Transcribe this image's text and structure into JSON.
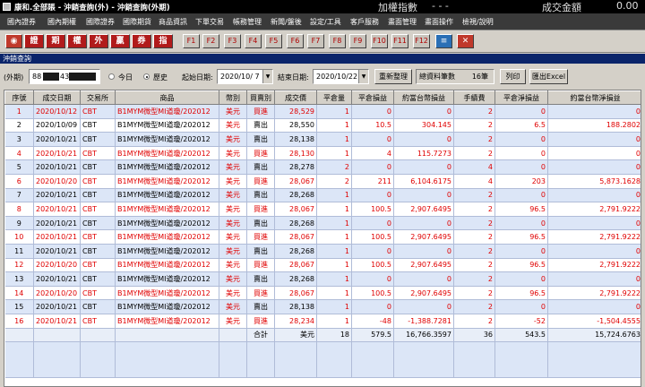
{
  "titlebar": {
    "title": "康和.全部賬 - 沖銷查詢(外) - 沖銷查詢(外期)",
    "index_label": "加權指數",
    "index_value": "- - -",
    "amount_label": "成交金額",
    "amount_value": "0.00"
  },
  "menu": [
    "國內證券",
    "國內期權",
    "國際證券",
    "國際期貨",
    "商品資訊",
    "下單交易",
    "帳務管理",
    "新聞/盤後",
    "設定/工具",
    "客戶服務",
    "畫面管理",
    "畫面操作",
    "檢視/說明"
  ],
  "toolbar": {
    "buttons": [
      "證",
      "期",
      "權",
      "外",
      "贏",
      "券",
      "指"
    ],
    "fkeys": [
      "F1",
      "F2",
      "F3",
      "F4",
      "F5",
      "F6",
      "F7",
      "F8",
      "F9",
      "F10",
      "F11",
      "F12"
    ]
  },
  "window": {
    "title": "沖銷查詢"
  },
  "filters": {
    "account_prefix": "(外期)",
    "account_visible": "88",
    "account_visible2": "43",
    "radio_today": "今日",
    "radio_history": "歷史",
    "start_label": "起始日期:",
    "start_date": "2020/10/ 7",
    "end_label": "結束日期:",
    "end_date": "2020/10/22",
    "reorganize": "重新整理",
    "total_count_label": "總資料筆數",
    "total_count": "16筆",
    "print": "列印",
    "export": "匯出Excel"
  },
  "columns": [
    "序號",
    "成交日期",
    "交易所",
    "商品",
    "幣別",
    "買賣別",
    "成交價",
    "平倉量",
    "平倉損益",
    "約當台幣損益",
    "手續費",
    "平倉淨損益",
    "約當台幣淨損益"
  ],
  "rows": [
    {
      "no": "1",
      "date": "2020/10/12",
      "ex": "CBT",
      "prod": "B1MYM微型MI道瓊/202012",
      "cur": "美元",
      "side": "買進",
      "price": "28,529",
      "qty": "1",
      "pl": "0",
      "twpl": "0",
      "fee": "2",
      "net": "0",
      "twnet": "0",
      "color": "red",
      "sidecolor": "buy"
    },
    {
      "no": "2",
      "date": "2020/10/09",
      "ex": "CBT",
      "prod": "B1MYM微型MI道瓊/202012",
      "cur": "美元",
      "side": "賣出",
      "price": "28,550",
      "qty": "1",
      "pl": "10.5",
      "twpl": "304.145",
      "fee": "2",
      "net": "6.5",
      "twnet": "188.2802",
      "color": "blk",
      "sidecolor": "sell"
    },
    {
      "no": "3",
      "date": "2020/10/21",
      "ex": "CBT",
      "prod": "B1MYM微型MI道瓊/202012",
      "cur": "美元",
      "side": "賣出",
      "price": "28,138",
      "qty": "1",
      "pl": "0",
      "twpl": "0",
      "fee": "2",
      "net": "0",
      "twnet": "0",
      "color": "blk",
      "sidecolor": "sell"
    },
    {
      "no": "4",
      "date": "2020/10/21",
      "ex": "CBT",
      "prod": "B1MYM微型MI道瓊/202012",
      "cur": "美元",
      "side": "買進",
      "price": "28,130",
      "qty": "1",
      "pl": "4",
      "twpl": "115.7273",
      "fee": "2",
      "net": "0",
      "twnet": "0",
      "color": "red",
      "sidecolor": "buy"
    },
    {
      "no": "5",
      "date": "2020/10/21",
      "ex": "CBT",
      "prod": "B1MYM微型MI道瓊/202012",
      "cur": "美元",
      "side": "賣出",
      "price": "28,278",
      "qty": "2",
      "pl": "0",
      "twpl": "0",
      "fee": "4",
      "net": "0",
      "twnet": "0",
      "color": "blk",
      "sidecolor": "sell"
    },
    {
      "no": "6",
      "date": "2020/10/20",
      "ex": "CBT",
      "prod": "B1MYM微型MI道瓊/202012",
      "cur": "美元",
      "side": "買進",
      "price": "28,067",
      "qty": "2",
      "pl": "211",
      "twpl": "6,104.6175",
      "fee": "4",
      "net": "203",
      "twnet": "5,873.1628",
      "color": "red",
      "sidecolor": "buy"
    },
    {
      "no": "7",
      "date": "2020/10/21",
      "ex": "CBT",
      "prod": "B1MYM微型MI道瓊/202012",
      "cur": "美元",
      "side": "賣出",
      "price": "28,268",
      "qty": "1",
      "pl": "0",
      "twpl": "0",
      "fee": "2",
      "net": "0",
      "twnet": "0",
      "color": "blk",
      "sidecolor": "sell"
    },
    {
      "no": "8",
      "date": "2020/10/21",
      "ex": "CBT",
      "prod": "B1MYM微型MI道瓊/202012",
      "cur": "美元",
      "side": "買進",
      "price": "28,067",
      "qty": "1",
      "pl": "100.5",
      "twpl": "2,907.6495",
      "fee": "2",
      "net": "96.5",
      "twnet": "2,791.9222",
      "color": "red",
      "sidecolor": "buy"
    },
    {
      "no": "9",
      "date": "2020/10/21",
      "ex": "CBT",
      "prod": "B1MYM微型MI道瓊/202012",
      "cur": "美元",
      "side": "賣出",
      "price": "28,268",
      "qty": "1",
      "pl": "0",
      "twpl": "0",
      "fee": "2",
      "net": "0",
      "twnet": "0",
      "color": "blk",
      "sidecolor": "sell"
    },
    {
      "no": "10",
      "date": "2020/10/21",
      "ex": "CBT",
      "prod": "B1MYM微型MI道瓊/202012",
      "cur": "美元",
      "side": "買進",
      "price": "28,067",
      "qty": "1",
      "pl": "100.5",
      "twpl": "2,907.6495",
      "fee": "2",
      "net": "96.5",
      "twnet": "2,791.9222",
      "color": "red",
      "sidecolor": "buy"
    },
    {
      "no": "11",
      "date": "2020/10/21",
      "ex": "CBT",
      "prod": "B1MYM微型MI道瓊/202012",
      "cur": "美元",
      "side": "賣出",
      "price": "28,268",
      "qty": "1",
      "pl": "0",
      "twpl": "0",
      "fee": "2",
      "net": "0",
      "twnet": "0",
      "color": "blk",
      "sidecolor": "sell"
    },
    {
      "no": "12",
      "date": "2020/10/20",
      "ex": "CBT",
      "prod": "B1MYM微型MI道瓊/202012",
      "cur": "美元",
      "side": "買進",
      "price": "28,067",
      "qty": "1",
      "pl": "100.5",
      "twpl": "2,907.6495",
      "fee": "2",
      "net": "96.5",
      "twnet": "2,791.9222",
      "color": "red",
      "sidecolor": "buy"
    },
    {
      "no": "13",
      "date": "2020/10/21",
      "ex": "CBT",
      "prod": "B1MYM微型MI道瓊/202012",
      "cur": "美元",
      "side": "賣出",
      "price": "28,268",
      "qty": "1",
      "pl": "0",
      "twpl": "0",
      "fee": "2",
      "net": "0",
      "twnet": "0",
      "color": "blk",
      "sidecolor": "sell"
    },
    {
      "no": "14",
      "date": "2020/10/20",
      "ex": "CBT",
      "prod": "B1MYM微型MI道瓊/202012",
      "cur": "美元",
      "side": "買進",
      "price": "28,067",
      "qty": "1",
      "pl": "100.5",
      "twpl": "2,907.6495",
      "fee": "2",
      "net": "96.5",
      "twnet": "2,791.9222",
      "color": "red",
      "sidecolor": "buy"
    },
    {
      "no": "15",
      "date": "2020/10/21",
      "ex": "CBT",
      "prod": "B1MYM微型MI道瓊/202012",
      "cur": "美元",
      "side": "賣出",
      "price": "28,138",
      "qty": "1",
      "pl": "0",
      "twpl": "0",
      "fee": "2",
      "net": "0",
      "twnet": "0",
      "color": "blk",
      "sidecolor": "sell"
    },
    {
      "no": "16",
      "date": "2020/10/21",
      "ex": "CBT",
      "prod": "B1MYM微型MI道瓊/202012",
      "cur": "美元",
      "side": "買進",
      "price": "28,234",
      "qty": "1",
      "pl": "-48",
      "twpl": "-1,388.7281",
      "fee": "2",
      "net": "-52",
      "twnet": "-1,504.4555",
      "color": "red",
      "sidecolor": "buy"
    }
  ],
  "total": {
    "label": "合計",
    "cur": "美元",
    "qty": "18",
    "pl": "579.5",
    "twpl": "16,766.3597",
    "fee": "36",
    "net": "543.5",
    "twnet": "15,724.6763"
  },
  "colors": {
    "buy": "#e00000",
    "sell": "#000000",
    "row_alt": "#dce6f7",
    "header_bg": "#0a246a"
  }
}
